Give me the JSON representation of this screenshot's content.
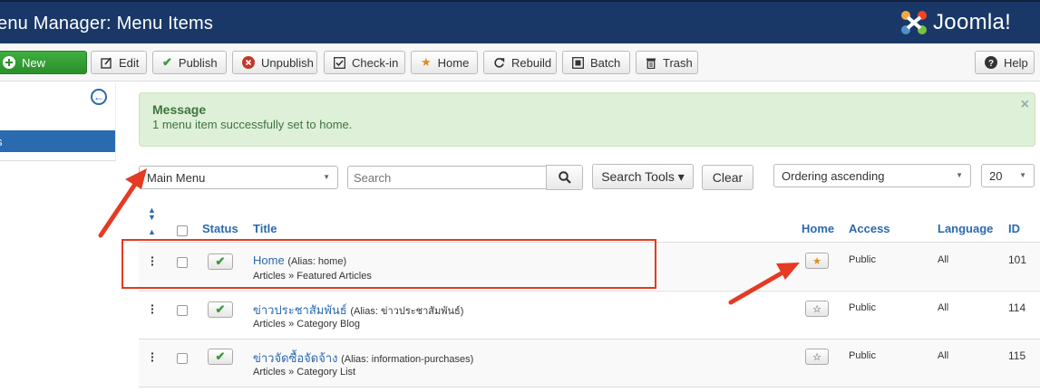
{
  "header": {
    "title": "enu Manager: Menu Items",
    "logo_text": "Joomla!"
  },
  "toolbar": {
    "new": "New",
    "edit": "Edit",
    "publish": "Publish",
    "unpublish": "Unpublish",
    "checkin": "Check-in",
    "home": "Home",
    "rebuild": "Rebuild",
    "batch": "Batch",
    "trash": "Trash",
    "help": "Help"
  },
  "sidebar": {
    "active_item": "s"
  },
  "message": {
    "heading": "Message",
    "body": "1 menu item successfully set to home."
  },
  "filters": {
    "menu_select": "Main Menu",
    "search_placeholder": "Search",
    "search_tools": "Search Tools ▾",
    "clear": "Clear",
    "ordering": "Ordering ascending",
    "limit": "20"
  },
  "table": {
    "headers": {
      "status": "Status",
      "title": "Title",
      "home": "Home",
      "access": "Access",
      "language": "Language",
      "id": "ID"
    },
    "rows": [
      {
        "title": "Home",
        "alias": "(Alias: home)",
        "sub": "Articles » Featured Articles",
        "home": true,
        "access": "Public",
        "language": "All",
        "id": "101"
      },
      {
        "title": "ข่าวประชาสัมพันธ์",
        "alias": "(Alias: ข่าวประชาสัมพันธ์)",
        "sub": "Articles » Category Blog",
        "home": false,
        "access": "Public",
        "language": "All",
        "id": "114"
      },
      {
        "title": "ข่าวจัดซื้อจัดจ้าง",
        "alias": "(Alias: information-purchases)",
        "sub": "Articles » Category List",
        "home": false,
        "access": "Public",
        "language": "All",
        "id": "115"
      }
    ]
  },
  "colors": {
    "header_bg": "#1a3867",
    "link": "#2a6ab0",
    "success_bg": "#dff0d8",
    "annotation": "#e53a23"
  }
}
